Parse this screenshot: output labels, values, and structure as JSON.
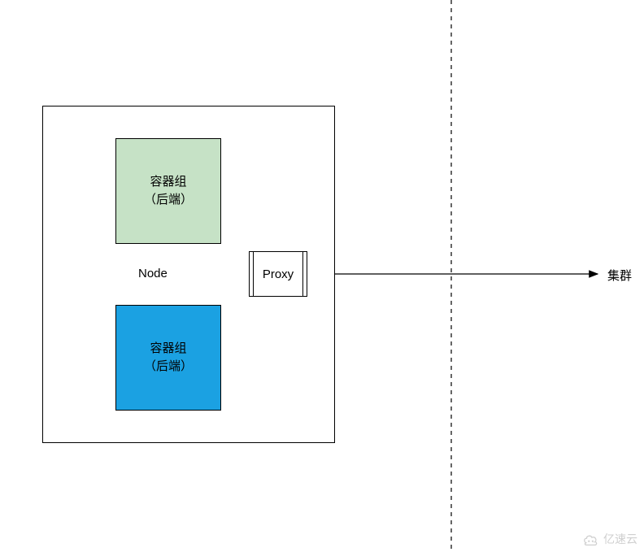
{
  "diagram": {
    "node": {
      "label": "Node",
      "pods": [
        {
          "line1": "容器组",
          "line2": "（后端）",
          "color": "#c6e2c6"
        },
        {
          "line1": "容器组",
          "line2": "（后端）",
          "color": "#1ba1e2"
        }
      ],
      "proxy": {
        "label": "Proxy"
      }
    },
    "cluster": {
      "label": "集群"
    }
  },
  "watermark": "亿速云"
}
